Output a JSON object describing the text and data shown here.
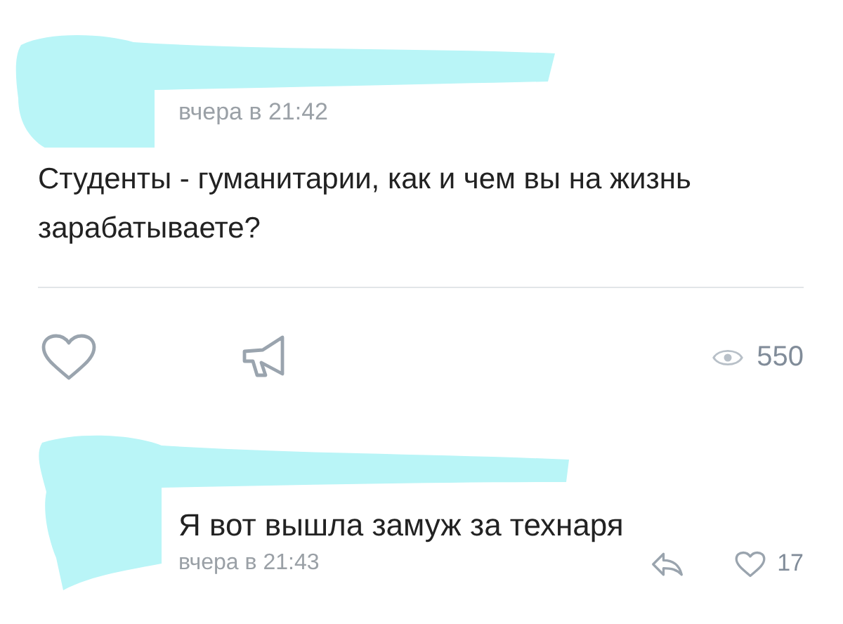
{
  "post": {
    "time": "вчера в 21:42",
    "text": "Студенты - гуманитарии, как и чем вы на жизнь зарабатываете?",
    "views": "550"
  },
  "comment": {
    "text": "Я вот вышла замуж за технаря",
    "time": "вчера в 21:43",
    "likes": "17"
  }
}
